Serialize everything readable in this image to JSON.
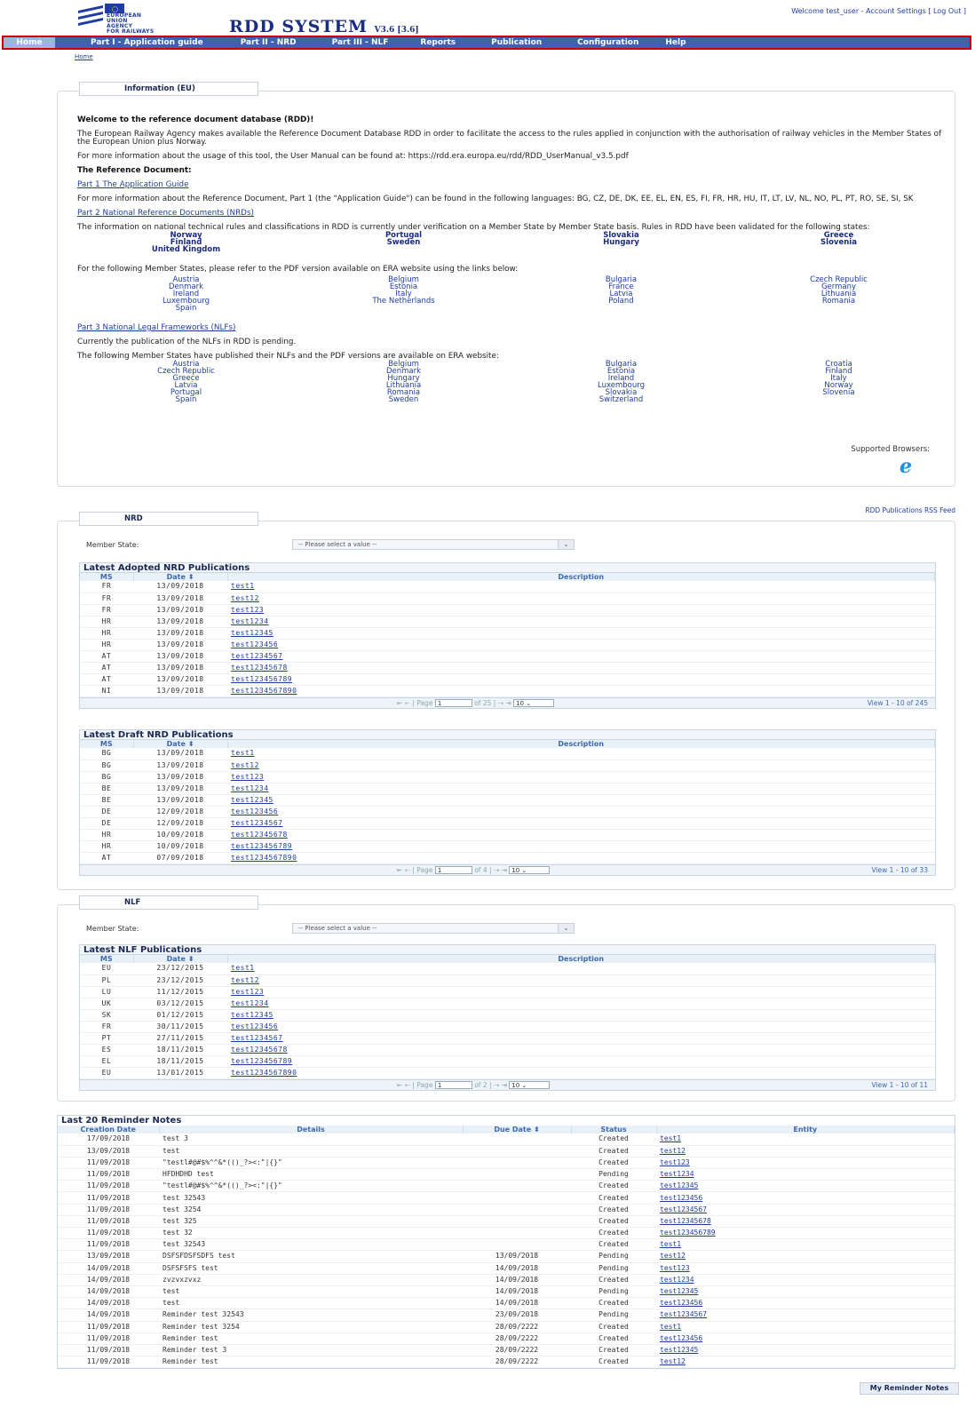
{
  "logo": {
    "org_lines": [
      "EUROPEAN",
      "UNION",
      "AGENCY",
      "FOR RAILWAYS"
    ]
  },
  "app_title": "RDD SYSTEM",
  "app_version": "V3.6 [3.6]",
  "top_links": {
    "welcome": "Welcome test_user -",
    "account": "Account Settings",
    "logout": "[ Log Out ]"
  },
  "menu": [
    "Home",
    "Part I - Application guide",
    "Part II - NRD",
    "Part III - NLF",
    "Reports",
    "Publication",
    "Configuration",
    "Help"
  ],
  "breadcrumb": "Home",
  "info": {
    "tab": "Information (EU)",
    "welcome": "Welcome to the reference document database (RDD)!",
    "intro": "The European Railway Agency makes available the Reference Document Database RDD in order to facilitate the access to the rules applied in conjunction with the authorisation of railway vehicles in the Member States of the European Union plus Norway.",
    "manual": "For more information about the usage of this tool, the User Manual can be found at: https://rdd.era.europa.eu/rdd/RDD_UserManual_v3.5.pdf",
    "ref_doc": "The Reference Document:",
    "part1_link": "Part 1 The Application Guide",
    "part1_text": "For more information about the Reference Document, Part 1 (the \"Application Guide\") can be found in the following languages: BG, CZ, DE, DK, EE, EL, EN, ES, FI, FR, HR, HU, IT, LT, LV, NL, NO, PL, PT, RO, SE, SI, SK",
    "part2_link": "Part 2 National Reference Documents (NRDs)",
    "part2_text": "The information on national technical rules and classifications in RDD is currently under verification on a Member State by Member State basis. Rules in RDD have been validated for the following states:",
    "validated": [
      [
        "Norway",
        "Finland",
        "United Kingdom"
      ],
      [
        "Portugal",
        "Sweden"
      ],
      [
        "Slovakia",
        "Hungary"
      ],
      [
        "Greece",
        "Slovenia"
      ]
    ],
    "pdf_text": "For the following Member States, please refer to the PDF version available on ERA website using the links below:",
    "pdf_states": [
      [
        "Austria",
        "Denmark",
        "Ireland",
        "Luxembourg",
        "Spain"
      ],
      [
        "Belgium",
        "Estonia",
        "Italy",
        "The Netherlands"
      ],
      [
        "Bulgaria",
        "France",
        "Latvia",
        "Poland"
      ],
      [
        "Czech Republic",
        "Germany",
        "Lithuania",
        "Romania"
      ]
    ],
    "part3_link": "Part 3 National Legal Frameworks (NLFs)",
    "part3_pending": "Currently the publication of the NLFs in RDD is pending.",
    "part3_text": "The following Member States have published their NLFs and the PDF versions are available on ERA website:",
    "nlf_states": [
      [
        "Austria",
        "Czech Republic",
        "Greece",
        "Latvia",
        "Portugal",
        "Spain"
      ],
      [
        "Belgium",
        "Denmark",
        "Hungary",
        "Lithuania",
        "Romania",
        "Sweden"
      ],
      [
        "Bulgaria",
        "Estonia",
        "Ireland",
        "Luxembourg",
        "Slovakia",
        "Switzerland"
      ],
      [
        "Croatia",
        "Finland",
        "Italy",
        "Norway",
        "Slovenia"
      ]
    ],
    "browsers": "Supported Browsers:",
    "ie_glyph": "e"
  },
  "rss": "RDD Publications RSS Feed",
  "nrd": {
    "tab": "NRD",
    "ms_label": "Member State:",
    "select": "-- Please select a value --",
    "adopted": {
      "title": "Latest Adopted NRD Publications",
      "headers": [
        "MS",
        "Date",
        "Description"
      ],
      "rows": [
        [
          "FR",
          "13/09/2018",
          "test1"
        ],
        [
          "FR",
          "13/09/2018",
          "test12"
        ],
        [
          "FR",
          "13/09/2018",
          "test123"
        ],
        [
          "HR",
          "13/09/2018",
          "test1234"
        ],
        [
          "HR",
          "13/09/2018",
          "test12345"
        ],
        [
          "HR",
          "13/09/2018",
          "test123456"
        ],
        [
          "AT",
          "13/09/2018",
          "test1234567"
        ],
        [
          "AT",
          "13/09/2018",
          "test12345678"
        ],
        [
          "AT",
          "13/09/2018",
          "test123456789"
        ],
        [
          "NI",
          "13/09/2018",
          "test1234567890"
        ]
      ],
      "page": "1",
      "of": "of 25",
      "per": "10",
      "view": "View 1 - 10 of 245"
    },
    "draft": {
      "title": "Latest Draft NRD Publications",
      "headers": [
        "MS",
        "Date",
        "Description"
      ],
      "rows": [
        [
          "BG",
          "13/09/2018",
          "test1"
        ],
        [
          "BG",
          "13/09/2018",
          "test12"
        ],
        [
          "BG",
          "13/09/2018",
          "test123"
        ],
        [
          "BE",
          "13/09/2018",
          "test1234"
        ],
        [
          "BE",
          "13/09/2018",
          "test12345"
        ],
        [
          "DE",
          "12/09/2018",
          "test123456"
        ],
        [
          "DE",
          "12/09/2018",
          "test1234567"
        ],
        [
          "HR",
          "10/09/2018",
          "test12345678"
        ],
        [
          "HR",
          "10/09/2018",
          "test123456789"
        ],
        [
          "AT",
          "07/09/2018",
          "test1234567890"
        ]
      ],
      "page": "1",
      "of": "of 4",
      "per": "10",
      "view": "View 1 - 10 of 33"
    }
  },
  "nlf": {
    "tab": "NLF",
    "ms_label": "Member State:",
    "select": "-- Please select a value --",
    "latest": {
      "title": "Latest NLF Publications",
      "headers": [
        "MS",
        "Date",
        "Description"
      ],
      "rows": [
        [
          "EU",
          "23/12/2015",
          "test1"
        ],
        [
          "PL",
          "23/12/2015",
          "test12"
        ],
        [
          "LU",
          "11/12/2015",
          "test123"
        ],
        [
          "UK",
          "03/12/2015",
          "test1234"
        ],
        [
          "SK",
          "01/12/2015",
          "test12345"
        ],
        [
          "FR",
          "30/11/2015",
          "test123456"
        ],
        [
          "PT",
          "27/11/2015",
          "test1234567"
        ],
        [
          "ES",
          "18/11/2015",
          "test12345678"
        ],
        [
          "EL",
          "18/11/2015",
          "test123456789"
        ],
        [
          "EU",
          "13/01/2015",
          "test1234567890"
        ]
      ],
      "page": "1",
      "of": "of 2",
      "per": "10",
      "view": "View 1 - 10 of 11"
    }
  },
  "reminders": {
    "title": "Last 20 Reminder Notes",
    "headers": [
      "Creation Date",
      "Details",
      "Due Date",
      "Status",
      "Entity"
    ],
    "rows": [
      [
        "17/09/2018",
        "test 3",
        "",
        "Created",
        "test1"
      ],
      [
        "13/09/2018",
        "test",
        "",
        "Created",
        "test12"
      ],
      [
        "11/09/2018",
        "\"testl#@#$%^^&*(()_?><:\"|{}\"",
        "",
        "Created",
        "test123"
      ],
      [
        "11/09/2018",
        "HFDHDHD test",
        "",
        "Pending",
        "test1234"
      ],
      [
        "11/09/2018",
        "\"testl#@#$%^^&*(()_?><:\"|{}\"",
        "",
        "Created",
        "test12345"
      ],
      [
        "11/09/2018",
        "test 32543",
        "",
        "Created",
        "test123456"
      ],
      [
        "11/09/2018",
        "test 3254",
        "",
        "Created",
        "test1234567"
      ],
      [
        "11/09/2018",
        "test 325",
        "",
        "Created",
        "test12345678"
      ],
      [
        "11/09/2018",
        "test 32",
        "",
        "Created",
        "test123456789"
      ],
      [
        "11/09/2018",
        "test 32543",
        "",
        "Created",
        "test1"
      ],
      [
        "13/09/2018",
        "DSFSFDSFSDFS test",
        "13/09/2018",
        "Pending",
        "test12"
      ],
      [
        "14/09/2018",
        "DSFSFSFS test",
        "14/09/2018",
        "Pending",
        "test123"
      ],
      [
        "14/09/2018",
        "zvzvxzvxz",
        "14/09/2018",
        "Created",
        "test1234"
      ],
      [
        "14/09/2018",
        "test",
        "14/09/2018",
        "Pending",
        "test12345"
      ],
      [
        "14/09/2018",
        "test",
        "14/09/2018",
        "Created",
        "test123456"
      ],
      [
        "14/09/2018",
        "Reminder test 32543",
        "23/09/2018",
        "Pending",
        "test1234567"
      ],
      [
        "11/09/2018",
        "Reminder test 3254",
        "28/09/2222",
        "Created",
        "test1"
      ],
      [
        "11/09/2018",
        "Reminder test",
        "28/09/2222",
        "Created",
        "test123456"
      ],
      [
        "11/09/2018",
        "Reminder test 3",
        "28/09/2222",
        "Created",
        "test12345"
      ],
      [
        "11/09/2018",
        "Reminder test",
        "28/09/2222",
        "Created",
        "test12"
      ]
    ]
  },
  "my_notes": "My Reminder Notes"
}
